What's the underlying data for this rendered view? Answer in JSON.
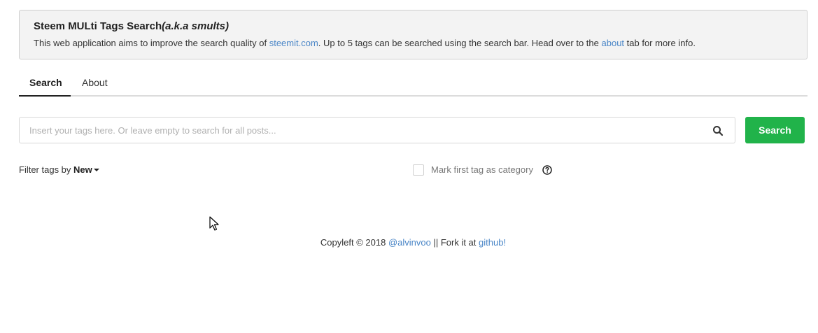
{
  "header": {
    "title": "Steem MULti Tags Search",
    "title_italic": "(a.k.a smults)",
    "desc_part1": "This web application aims to improve the search quality of ",
    "desc_link1": "steemit.com",
    "desc_part2": ". Up to 5 tags can be searched using the search bar. Head over to the ",
    "desc_link2": "about",
    "desc_part3": " tab for more info."
  },
  "tabs": [
    {
      "label": "Search",
      "active": true
    },
    {
      "label": "About",
      "active": false
    }
  ],
  "search": {
    "placeholder": "Insert your tags here. Or leave empty to search for all posts...",
    "value": "",
    "icon": "search-icon",
    "button_label": "Search"
  },
  "filter": {
    "label": "Filter tags by ",
    "selected": "New"
  },
  "category": {
    "label": "Mark first tag as category",
    "checked": false,
    "help_icon": "question-circle-icon"
  },
  "footer": {
    "text1": "Copyleft © 2018 ",
    "user_link": "@alvinvoo",
    "text2": " || Fork it at ",
    "repo_link": "github!"
  },
  "colors": {
    "accent_button": "#21b34a",
    "link": "#4a86c7",
    "header_bg": "#f3f3f3"
  }
}
